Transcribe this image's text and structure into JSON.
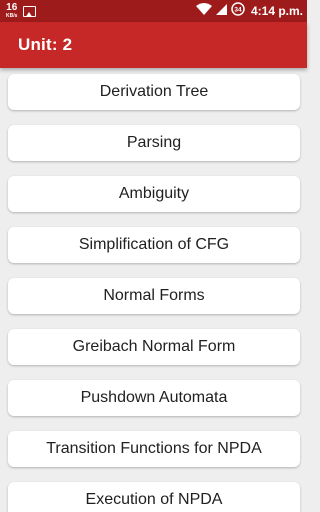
{
  "status_bar": {
    "net_speed_value": "16",
    "net_speed_unit": "KB/s",
    "battery_level": "34",
    "time": "4:14 p.m."
  },
  "app_bar": {
    "title": "Unit: 2"
  },
  "topics": [
    "Derivation Tree",
    "Parsing",
    "Ambiguity",
    "Simplification of CFG",
    "Normal Forms",
    "Greibach Normal Form",
    "Pushdown Automata",
    "Transition Functions for NPDA",
    "Execution of NPDA"
  ],
  "colors": {
    "status_bar": "#9e1b1b",
    "app_bar": "#c62828",
    "background": "#eeeeee",
    "card": "#ffffff",
    "text": "#212121"
  }
}
